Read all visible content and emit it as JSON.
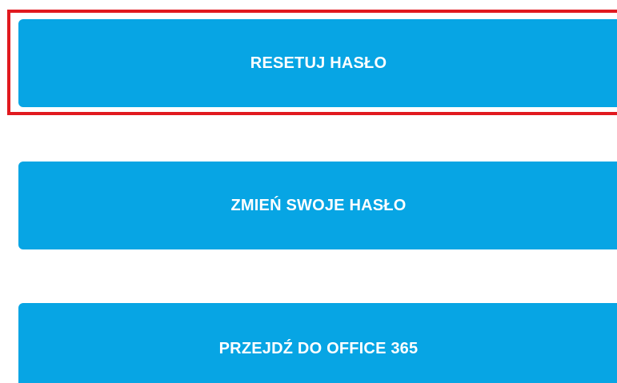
{
  "buttons": {
    "reset_password": "RESETUJ HASŁO",
    "change_password": "ZMIEŃ SWOJE HASŁO",
    "go_to_office": "PRZEJDŹ DO OFFICE 365"
  },
  "colors": {
    "button_bg": "#07a5e4",
    "button_text": "#ffffff",
    "highlight_border": "#e1191f"
  }
}
